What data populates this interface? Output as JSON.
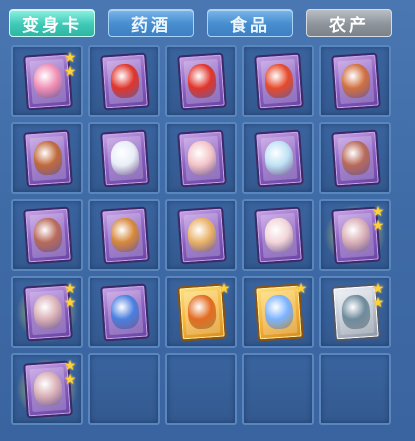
{
  "tabs": [
    {
      "label": "变身卡",
      "state": "active"
    },
    {
      "label": "药酒",
      "state": "normal"
    },
    {
      "label": "食品",
      "state": "normal"
    },
    {
      "label": "农产",
      "state": "disabled"
    }
  ],
  "colors": {
    "panel_bg": "#3f6aa3",
    "slot_border": "#5a86be",
    "active_tab": "#40c9b6",
    "tab_blue": "#4a8fd0",
    "tab_grey": "#8e949b",
    "star": "#ffd23a"
  },
  "inventory": [
    {
      "card": "purple",
      "icon": "pink-dragon-card-icon",
      "figure": "#f08fb5",
      "stars": 2,
      "glow": false
    },
    {
      "card": "purple",
      "icon": "red-lion-dancer-card-icon",
      "figure": "#e0352b",
      "stars": 0,
      "glow": false
    },
    {
      "card": "purple",
      "icon": "red-lion-dancer-card-icon",
      "figure": "#e0352b",
      "stars": 0,
      "glow": false
    },
    {
      "card": "purple",
      "icon": "red-rider-card-icon",
      "figure": "#e64a2a",
      "stars": 0,
      "glow": false
    },
    {
      "card": "purple",
      "icon": "monkey-king-card-icon",
      "figure": "#d07040",
      "stars": 0,
      "glow": false
    },
    {
      "card": "purple",
      "icon": "monkey-king-card-icon",
      "figure": "#c06a3a",
      "stars": 0,
      "glow": false
    },
    {
      "card": "purple",
      "icon": "white-ram-card-icon",
      "figure": "#e8eef7",
      "stars": 0,
      "glow": false
    },
    {
      "card": "purple",
      "icon": "pig-card-icon",
      "figure": "#f3c4c8",
      "stars": 0,
      "glow": false
    },
    {
      "card": "purple",
      "icon": "ice-dragon-card-icon",
      "figure": "#bfe2f5",
      "stars": 0,
      "glow": false
    },
    {
      "card": "purple",
      "icon": "boar-card-icon",
      "figure": "#b86a5a",
      "stars": 0,
      "glow": false
    },
    {
      "card": "purple",
      "icon": "boar-card-icon",
      "figure": "#b86a5a",
      "stars": 0,
      "glow": false
    },
    {
      "card": "purple",
      "icon": "tiger-card-icon",
      "figure": "#d6893c",
      "stars": 0,
      "glow": false
    },
    {
      "card": "purple",
      "icon": "golden-pig-card-icon",
      "figure": "#e9b267",
      "stars": 0,
      "glow": false
    },
    {
      "card": "purple",
      "icon": "dancer-card-icon",
      "figure": "#f2d5d8",
      "stars": 0,
      "glow": false
    },
    {
      "card": "purple",
      "icon": "bat-dancer-card-icon",
      "figure": "#d9b0b6",
      "stars": 2,
      "glow": true
    },
    {
      "card": "purple",
      "icon": "bat-dancer-card-icon",
      "figure": "#d9b0b6",
      "stars": 2,
      "glow": true
    },
    {
      "card": "purple",
      "icon": "blue-warrior-card-icon",
      "figure": "#4a7fe0",
      "stars": 0,
      "glow": false
    },
    {
      "card": "gold",
      "icon": "fire-beast-card-icon",
      "figure": "#e36b1f",
      "stars": 1,
      "glow": false
    },
    {
      "card": "gold",
      "icon": "fairy-card-icon",
      "figure": "#7bb3ff",
      "stars": 1,
      "glow": false
    },
    {
      "card": "silver",
      "icon": "armored-general-card-icon",
      "figure": "#6d8a9c",
      "stars": 2,
      "glow": false
    },
    {
      "card": "purple",
      "icon": "bat-dancer-card-icon",
      "figure": "#d9b0b6",
      "stars": 2,
      "glow": true
    },
    {
      "card": "empty"
    },
    {
      "card": "empty"
    },
    {
      "card": "empty"
    },
    {
      "card": "empty"
    }
  ],
  "star_glyph": "★"
}
